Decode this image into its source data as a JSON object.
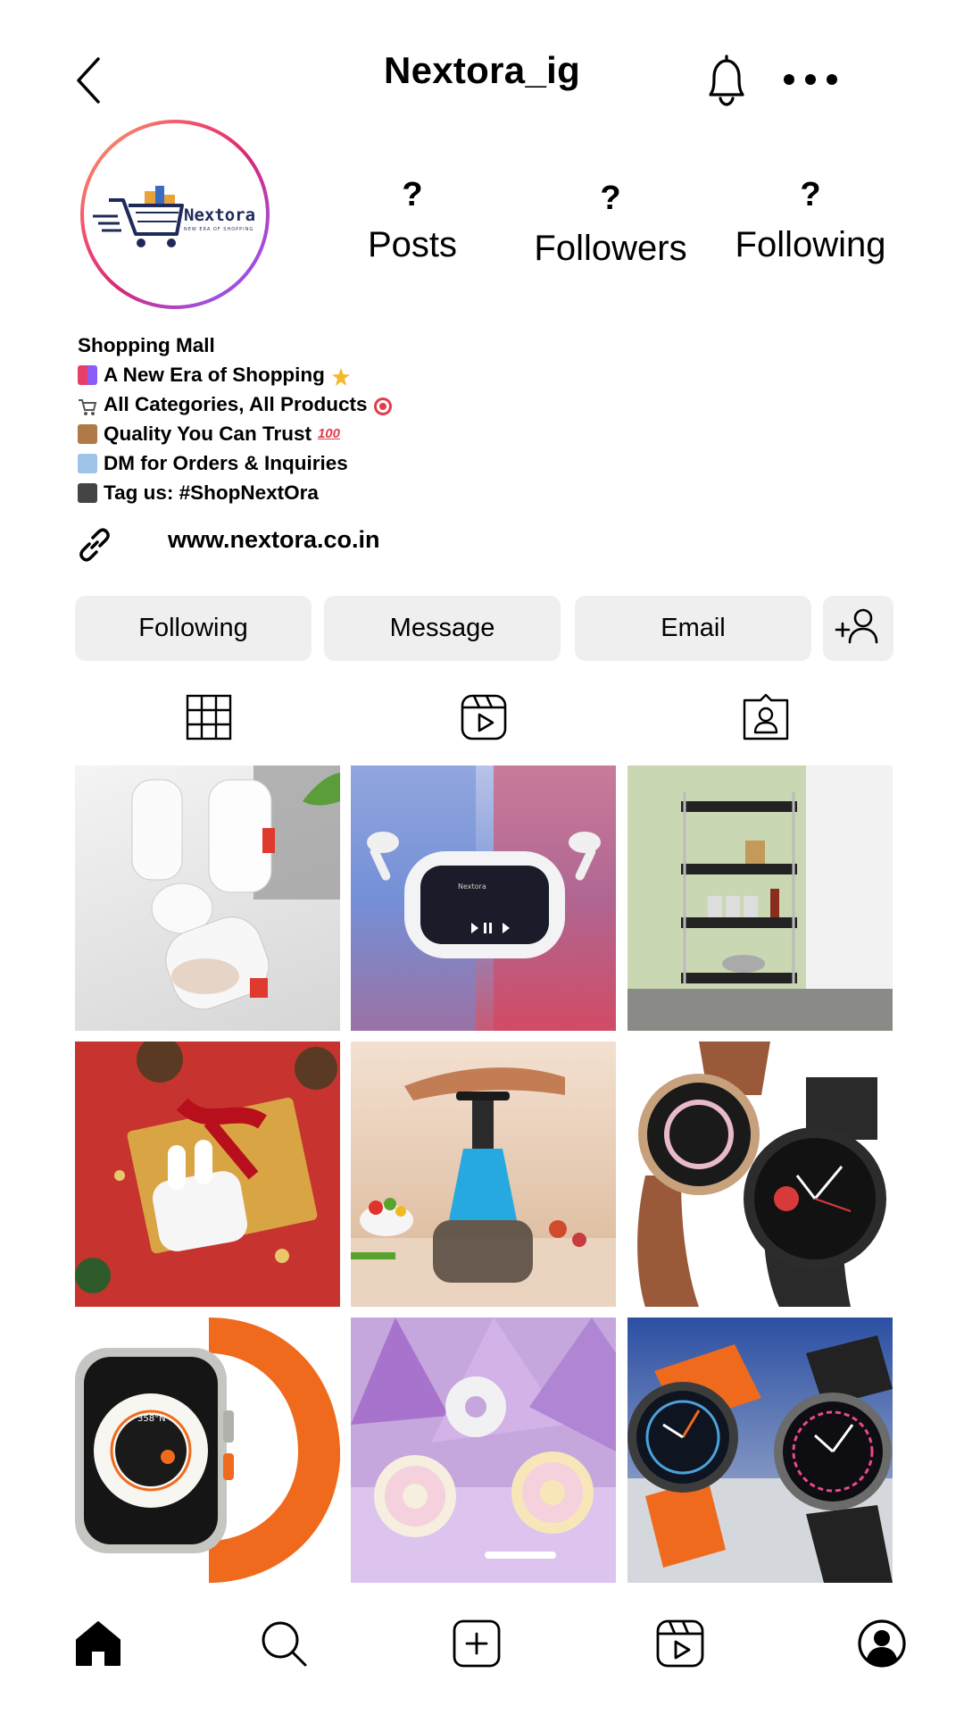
{
  "header": {
    "title": "Nextora_ig",
    "icons": {
      "back": "chevron-left-icon",
      "notifications": "bell-icon",
      "more": "more-horizontal-icon"
    }
  },
  "profile": {
    "avatar_logo": {
      "name": "Nextora",
      "tagline": "NEW ERA OF SHOPPING"
    },
    "stats": [
      {
        "value": "?",
        "label": "Posts"
      },
      {
        "value": "?",
        "label": "Followers"
      },
      {
        "value": "?",
        "label": "Following"
      }
    ],
    "bio": {
      "category": "Shopping Mall",
      "lines": [
        {
          "icon": "shopping-bags-emoji",
          "text": "A New Era of Shopping",
          "trail_icon": "sparkle-emoji"
        },
        {
          "icon": "shopping-cart-emoji",
          "text": "All Categories, All Products",
          "trail_icon": "target-emoji"
        },
        {
          "icon": "package-emoji",
          "text": "Quality You Can Trust",
          "trail_icon": "hundred-emoji"
        },
        {
          "icon": "inbox-emoji",
          "text": "DM for Orders & Inquiries",
          "trail_icon": ""
        },
        {
          "icon": "camera-emoji",
          "text": "Tag us: #ShopNextOra",
          "trail_icon": ""
        }
      ]
    },
    "website": "www.nextora.co.in"
  },
  "actions": {
    "following_label": "Following",
    "message_label": "Message",
    "email_label": "Email",
    "add_user_icon": "add-user-icon"
  },
  "tabs": [
    {
      "name": "posts-grid",
      "icon": "grid-icon"
    },
    {
      "name": "reels",
      "icon": "reels-icon"
    },
    {
      "name": "tagged",
      "icon": "tagged-user-icon"
    }
  ],
  "posts": [
    "soap-holder-cases",
    "earbuds-smart-case",
    "kitchen-storage-trolley",
    "christmas-earbuds-gift",
    "hand-press-chopper",
    "galaxy-smartwatches",
    "orange-band-smartwatch",
    "donut-lunch-boxes",
    "twin-smartwatches"
  ],
  "bottom_nav": [
    {
      "name": "home",
      "icon": "home-icon"
    },
    {
      "name": "search",
      "icon": "search-icon"
    },
    {
      "name": "create",
      "icon": "create-icon"
    },
    {
      "name": "reels",
      "icon": "reels-icon"
    },
    {
      "name": "profile",
      "icon": "profile-icon"
    }
  ]
}
